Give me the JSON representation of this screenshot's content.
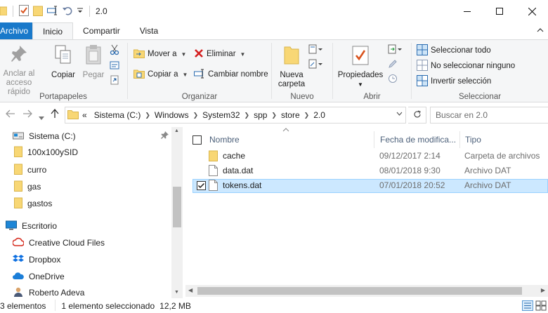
{
  "window": {
    "title": "2.0",
    "minimize_glyph": "—",
    "maximize_glyph": "☐",
    "close_glyph": "✕"
  },
  "ribbon_tabs": {
    "file": "Archivo",
    "home": "Inicio",
    "share": "Compartir",
    "view": "Vista"
  },
  "ribbon": {
    "clipboard": {
      "label": "Portapapeles",
      "pin": "Anclar al acceso rápido",
      "copy": "Copiar",
      "paste": "Pegar"
    },
    "organize": {
      "label": "Organizar",
      "move_to": "Mover a",
      "copy_to": "Copiar a",
      "delete": "Eliminar",
      "rename": "Cambiar nombre"
    },
    "new": {
      "label": "Nuevo",
      "new_folder": "Nueva carpeta"
    },
    "open": {
      "label": "Abrir",
      "properties": "Propiedades"
    },
    "select": {
      "label": "Seleccionar",
      "select_all": "Seleccionar todo",
      "select_none": "No seleccionar ninguno",
      "invert": "Invertir selección"
    }
  },
  "address": {
    "prefix": "«",
    "crumbs": [
      "Sistema (C:)",
      "Windows",
      "System32",
      "spp",
      "store",
      "2.0"
    ],
    "search_placeholder": "Buscar en 2.0"
  },
  "nav_pane": {
    "items": [
      {
        "label": "Sistema (C:)",
        "icon": "drive-icon"
      },
      {
        "label": "100x100ySID",
        "icon": "folder-icon"
      },
      {
        "label": "curro",
        "icon": "folder-icon"
      },
      {
        "label": "gas",
        "icon": "folder-icon"
      },
      {
        "label": "gastos",
        "icon": "folder-icon"
      },
      {
        "label": "Escritorio",
        "icon": "desktop-icon"
      },
      {
        "label": "Creative Cloud Files",
        "icon": "creative-cloud-icon"
      },
      {
        "label": "Dropbox",
        "icon": "dropbox-icon"
      },
      {
        "label": "OneDrive",
        "icon": "onedrive-icon"
      },
      {
        "label": "Roberto Adeva",
        "icon": "user-icon"
      }
    ]
  },
  "file_list": {
    "columns": {
      "name": "Nombre",
      "date": "Fecha de modifica...",
      "type": "Tipo"
    },
    "rows": [
      {
        "name": "cache",
        "date": "09/12/2017 2:14",
        "type": "Carpeta de archivos",
        "icon": "folder-icon",
        "selected": false
      },
      {
        "name": "data.dat",
        "date": "08/01/2018 9:30",
        "type": "Archivo DAT",
        "icon": "file-icon",
        "selected": false
      },
      {
        "name": "tokens.dat",
        "date": "07/01/2018 20:52",
        "type": "Archivo DAT",
        "icon": "file-icon",
        "selected": true
      }
    ]
  },
  "status": {
    "count": "3 elementos",
    "selection": "1 elemento seleccionado",
    "size": "12,2 MB"
  },
  "colors": {
    "file_tab": "#1979ca",
    "selection_bg": "#cce8ff",
    "selection_border": "#99d1ff",
    "folder": "#f8d775"
  }
}
